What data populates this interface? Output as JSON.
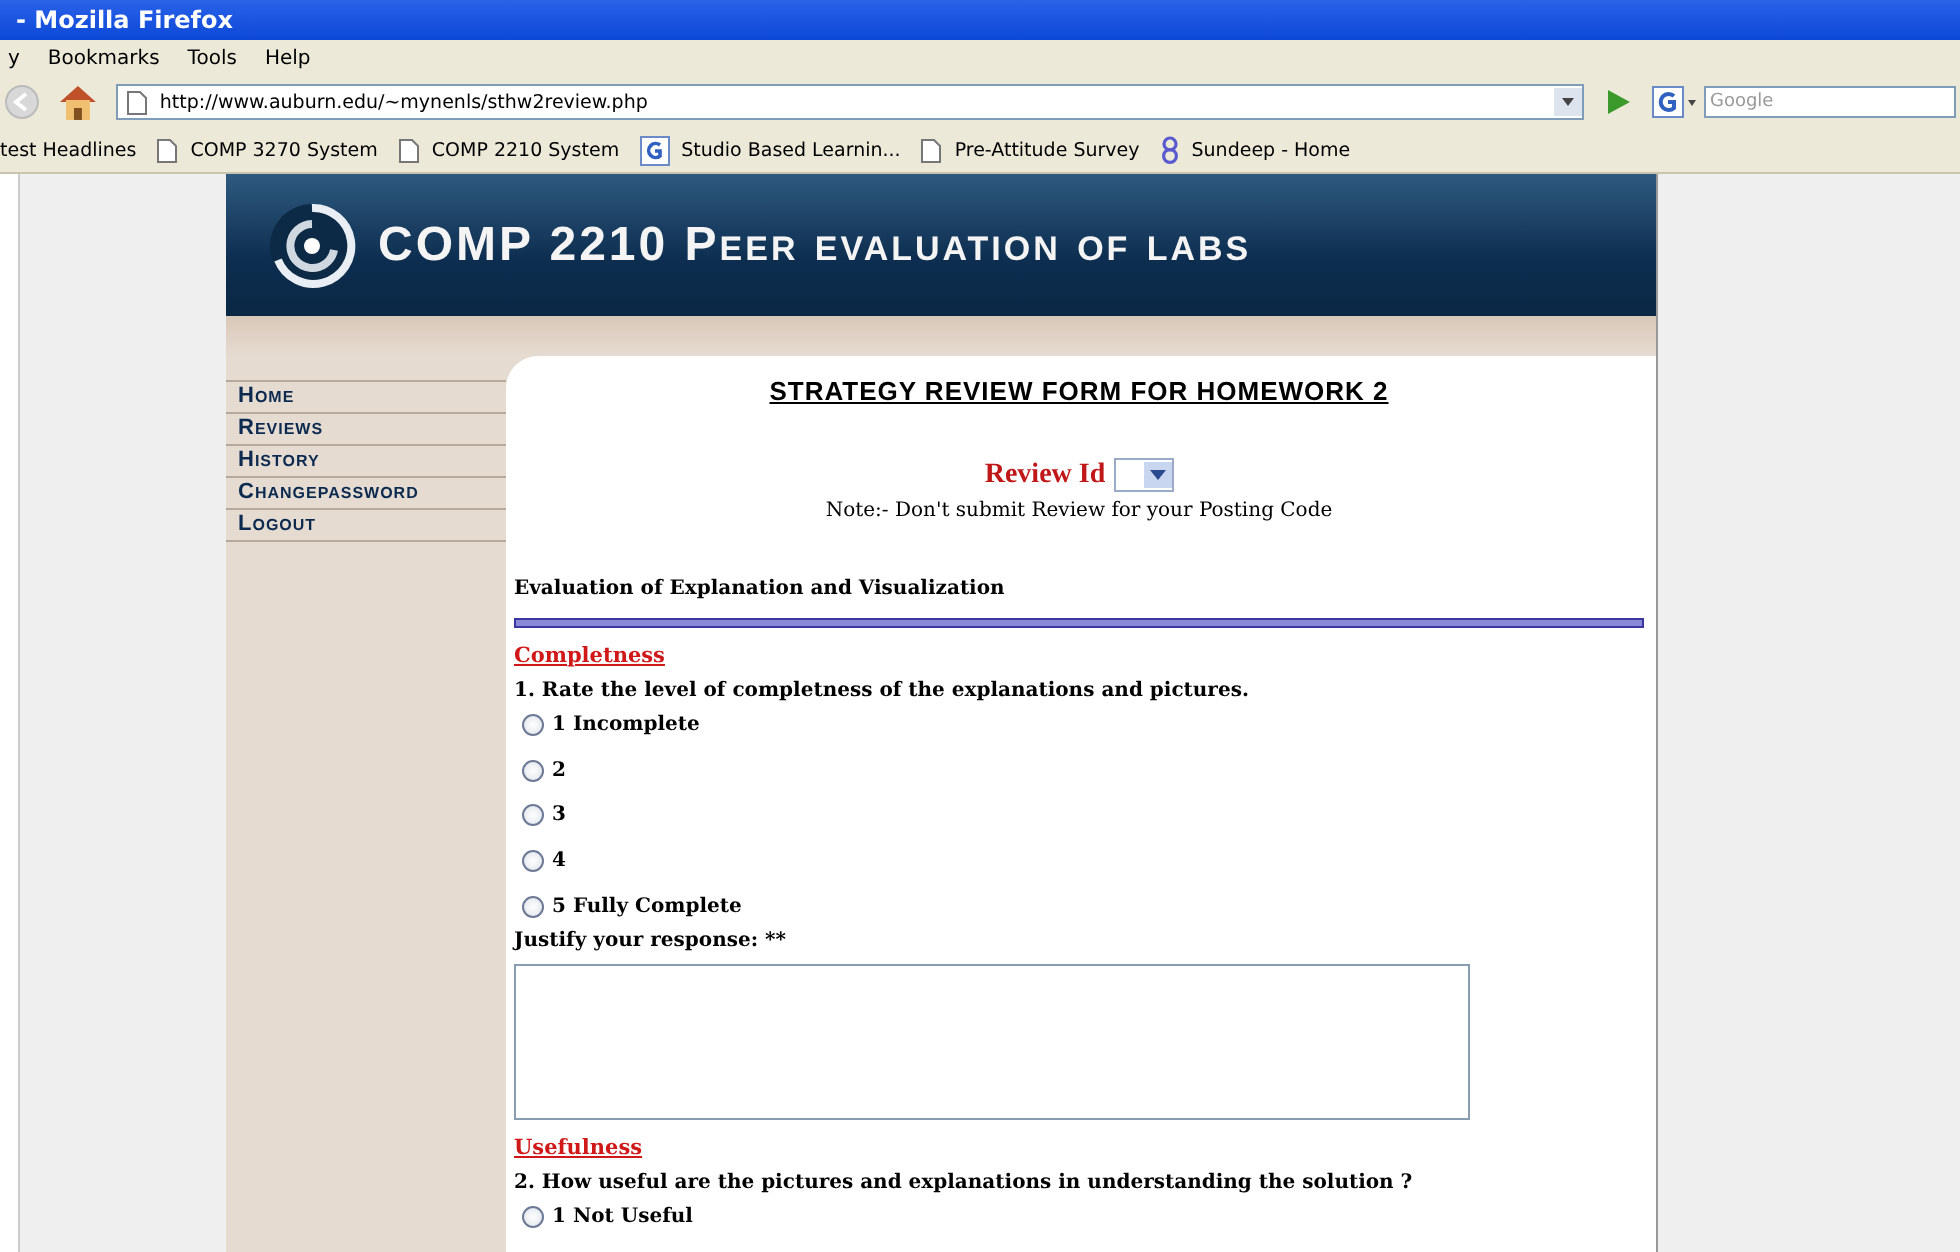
{
  "window": {
    "title": "- Mozilla Firefox"
  },
  "menu": [
    "y",
    "Bookmarks",
    "Tools",
    "Help"
  ],
  "address_bar": {
    "value": "http://www.auburn.edu/~mynenls/sthw2review.php"
  },
  "search": {
    "placeholder": "Google"
  },
  "bookmarks": [
    {
      "label": "test Headlines",
      "kind": "plain"
    },
    {
      "label": "COMP 3270 System",
      "kind": "page"
    },
    {
      "label": "COMP 2210 System",
      "kind": "page"
    },
    {
      "label": "Studio Based Learnin...",
      "kind": "google"
    },
    {
      "label": "Pre-Attitude Survey",
      "kind": "page"
    },
    {
      "label": "Sundeep - Home",
      "kind": "eight"
    }
  ],
  "banner": {
    "title": "COMP 2210 Peer evaluation of labs"
  },
  "sidebar": {
    "items": [
      "Home",
      "Reviews",
      "History",
      "Changepassword",
      "Logout"
    ]
  },
  "form": {
    "title": "STRATEGY REVIEW FORM FOR HOMEWORK 2",
    "review_id_label": "Review Id",
    "note": "Note:- Don't submit Review for your Posting Code",
    "section": "Evaluation of Explanation and Visualization",
    "questions": [
      {
        "heading": "Completness",
        "prompt": "1. Rate the level of completness of the explanations and pictures.",
        "options": [
          {
            "label": "1 Incomplete",
            "selected": false
          },
          {
            "label": "2",
            "selected": false
          },
          {
            "label": "3",
            "selected": false
          },
          {
            "label": "4",
            "selected": false
          },
          {
            "label": "5 Fully Complete",
            "selected": false
          }
        ],
        "justify_label": "Justify your response: **"
      },
      {
        "heading": "Usefulness",
        "prompt": "2. How useful are the pictures and explanations in understanding the solution ?",
        "options": [
          {
            "label": "1 Not Useful",
            "selected": false
          }
        ]
      }
    ]
  }
}
